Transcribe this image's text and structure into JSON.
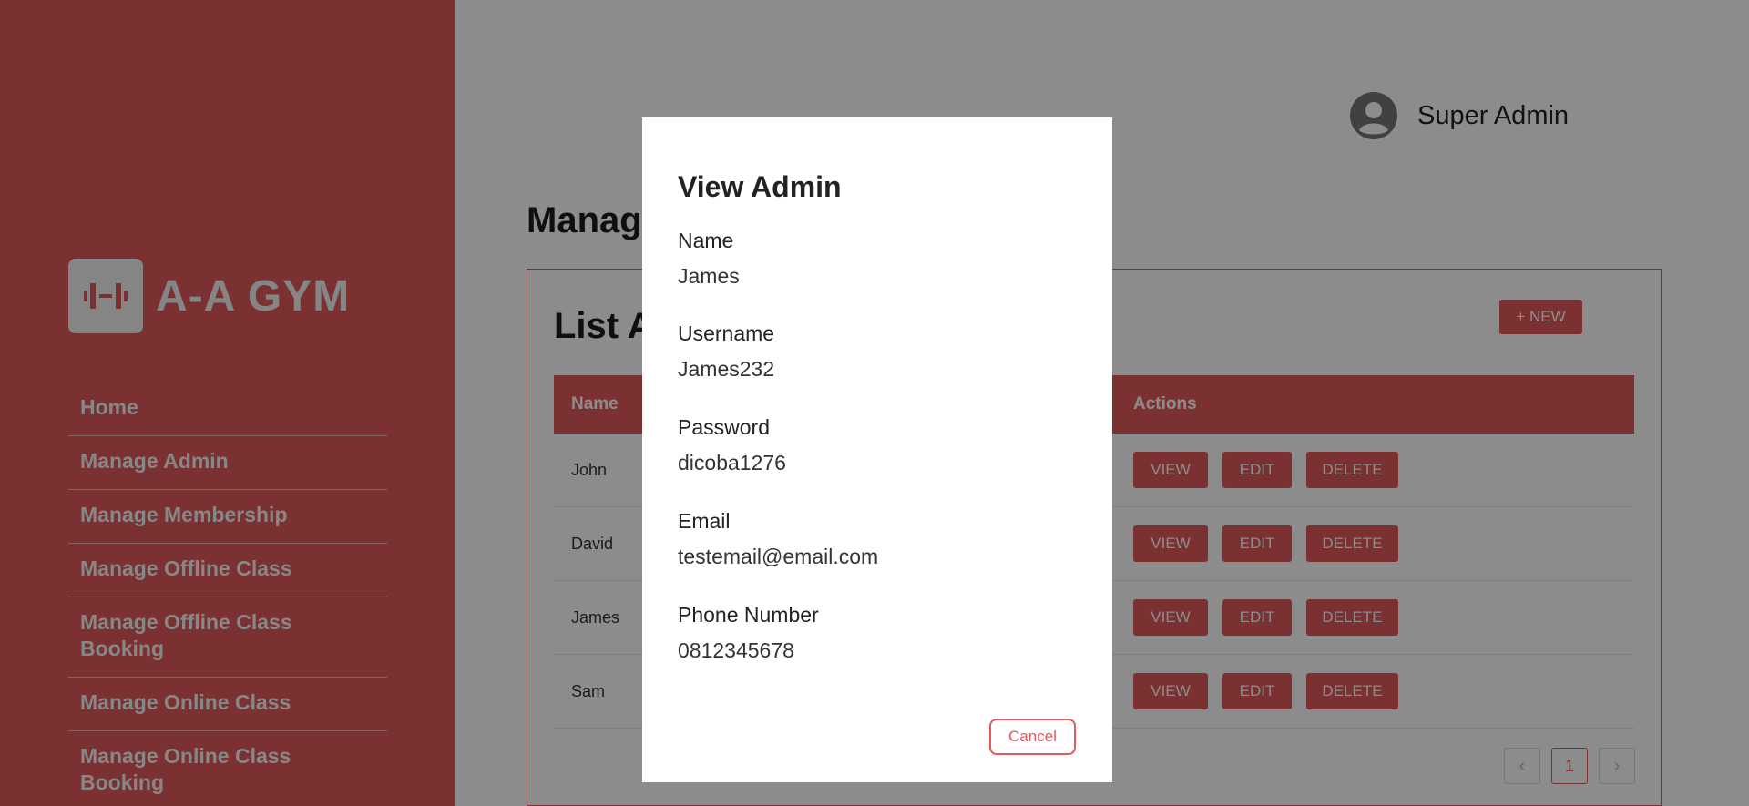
{
  "colors": {
    "accent": "#e15959",
    "sidebar_text": "#f6f6f6"
  },
  "brand": {
    "name": "A-A GYM",
    "logo_icon": "dumbbell-icon"
  },
  "sidebar": {
    "items": [
      {
        "label": "Home"
      },
      {
        "label": "Manage Admin"
      },
      {
        "label": "Manage Membership"
      },
      {
        "label": "Manage Offline Class"
      },
      {
        "label": "Manage Offline Class Booking"
      },
      {
        "label": "Manage Online Class"
      },
      {
        "label": "Manage Online Class Booking"
      }
    ]
  },
  "header": {
    "user_name": "Super Admin",
    "avatar_icon": "user-circle-icon"
  },
  "page": {
    "title": "Manage Admin"
  },
  "list": {
    "title": "List Admin",
    "new_button": "+ NEW",
    "columns": {
      "name": "Name",
      "actions": "Actions"
    },
    "rows": [
      {
        "name": "John"
      },
      {
        "name": "David"
      },
      {
        "name": "James"
      },
      {
        "name": "Sam"
      }
    ],
    "action_labels": {
      "view": "VIEW",
      "edit": "EDIT",
      "delete": "DELETE"
    },
    "pagination": {
      "prev": "‹",
      "current": "1",
      "next": "›"
    }
  },
  "modal": {
    "title": "View Admin",
    "fields": [
      {
        "label": "Name",
        "value": "James"
      },
      {
        "label": "Username",
        "value": "James232"
      },
      {
        "label": "Password",
        "value": "dicoba1276"
      },
      {
        "label": "Email",
        "value": "testemail@email.com"
      },
      {
        "label": "Phone Number",
        "value": "0812345678"
      }
    ],
    "cancel_label": "Cancel"
  }
}
